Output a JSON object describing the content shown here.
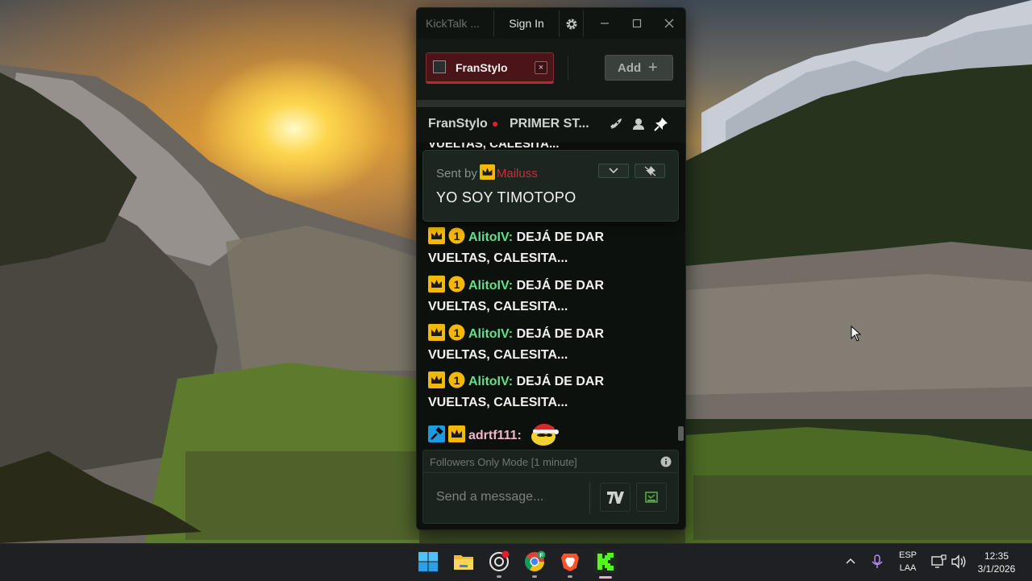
{
  "window": {
    "app_title": "KickTalk ...",
    "sign_in_label": "Sign In",
    "settings_icon": "gear-icon",
    "controls": [
      "minimize-icon",
      "maximize-icon",
      "close-icon"
    ]
  },
  "tabs": {
    "active": {
      "label": "FranStylo",
      "close_label": "×"
    },
    "add_label": "Add",
    "add_icon": "+"
  },
  "chat_header": {
    "channel_name": "FranStylo",
    "live": true,
    "stream_title": "PRIMER ST...",
    "icons": [
      "rocket-icon",
      "user-icon",
      "pin-icon"
    ]
  },
  "pinned": {
    "sent_by_label": "Sent by",
    "username": "Mailuss",
    "message": "YO SOY TIMOTOPO",
    "username_color": "#d6263a"
  },
  "messages": {
    "partial_top": "VUELTAS, CALESITA...",
    "list": [
      {
        "user": "AlitoIV:",
        "line1": "DEJÁ DE DAR",
        "line2": "VUELTAS, CALESITA..."
      },
      {
        "user": "AlitoIV:",
        "line1": "DEJÁ DE DAR",
        "line2": "VUELTAS, CALESITA..."
      },
      {
        "user": "AlitoIV:",
        "line1": "DEJÁ DE DAR",
        "line2": "VUELTAS, CALESITA..."
      },
      {
        "user": "AlitoIV:",
        "line1": "DEJÁ DE DAR",
        "line2": "VUELTAS, CALESITA..."
      }
    ],
    "last": {
      "user": "adrtf111:",
      "emote": "santa-hat-emote"
    },
    "user_color": "#62e08a"
  },
  "composer": {
    "mode_notice": "Followers Only Mode [1 minute]",
    "placeholder": "Send a message...",
    "value": ""
  },
  "taskbar": {
    "apps": [
      "windows-start-icon",
      "file-explorer-icon",
      "chatgpt-icon",
      "chrome-icon",
      "brave-icon",
      "kick-icon"
    ],
    "chrome_badge": "F",
    "language_top": "ESP",
    "language_bottom": "LAA",
    "time": "12:35",
    "date": "3/1/2026"
  }
}
